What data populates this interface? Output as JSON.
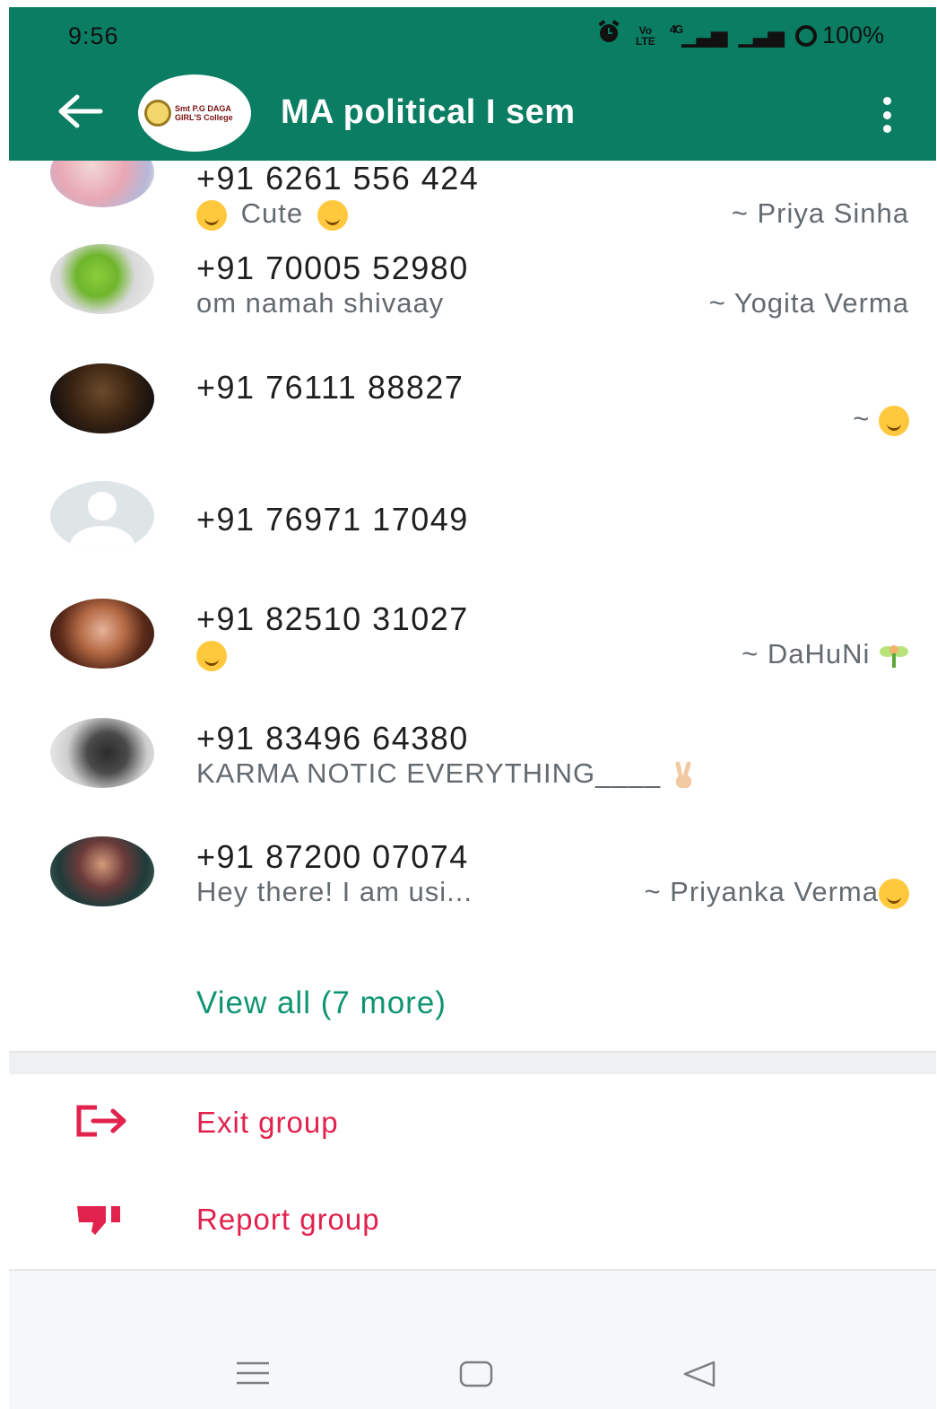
{
  "status_bar": {
    "time": "9:56",
    "volte_label": "Vo LTE",
    "network_label": "4G",
    "battery": "100%"
  },
  "header": {
    "title": "MA political I sem",
    "group_logo_text": "Smt P.G DAGA GIRL'S College",
    "colors": {
      "background": "#0a7d63",
      "text": "#ffffff"
    }
  },
  "participants": [
    {
      "phone": "+91 6261 556 424",
      "about": "Cute",
      "name": "~ Priya Sinha",
      "about_emoji": "smiling-face-with-hearts"
    },
    {
      "phone": "+91 70005 52980",
      "about": "om namah shivaay",
      "name": "~ Yogita Verma"
    },
    {
      "phone": "+91 76111 88827",
      "about": "",
      "name": "~",
      "name_emoji": "party-face"
    },
    {
      "phone": "+91 76971 17049",
      "about": "",
      "name": ""
    },
    {
      "phone": "+91 82510 31027",
      "about": "",
      "name": "~ DaHuNi",
      "about_emoji": "smiling-face-with-halo",
      "name_emoji": "fairy"
    },
    {
      "phone": "+91 83496 64380",
      "about": "KARMA NOTIC EVERYTHING____",
      "name": "",
      "about_emoji": "victory-hand"
    },
    {
      "phone": "+91 87200 07074",
      "about": "Hey there! I am usi...",
      "name": "~ Priyanka Verma",
      "name_emoji": "smiling-face-with-hearts"
    }
  ],
  "view_all": "View all (7 more)",
  "actions": {
    "exit_group": "Exit group",
    "report_group": "Report group",
    "danger_color": "#e0224d"
  },
  "accent_color": "#109472",
  "icons": [
    "back-arrow-icon",
    "more-options-icon",
    "exit-icon",
    "thumbs-down-icon",
    "menu-icon",
    "home-icon",
    "back-nav-icon"
  ]
}
